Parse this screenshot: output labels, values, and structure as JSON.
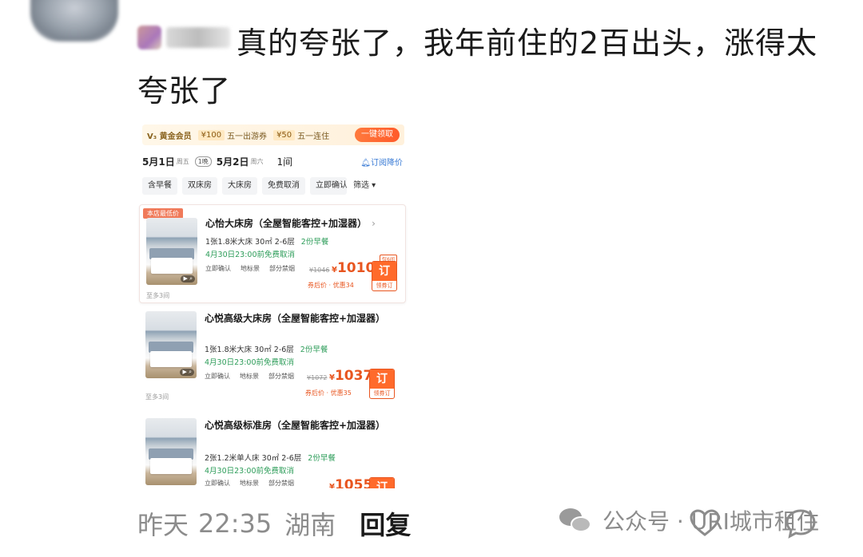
{
  "comment": {
    "text": "真的夸张了，我年前住的2百出头，涨得太夸张了"
  },
  "screenshot": {
    "member_bar": {
      "vip_label": "V₃ 黄金会员",
      "coupons": [
        {
          "amount": "¥100",
          "desc": "五一出游券"
        },
        {
          "amount": "¥50",
          "desc": "五一连住"
        }
      ],
      "claim_label": "一键领取"
    },
    "dates": {
      "checkin": "5月1日",
      "checkin_weekday": "周五",
      "nights": "1晚",
      "checkout": "5月2日",
      "checkout_weekday": "周六",
      "rooms": "1间",
      "subscribe": "订阅降价"
    },
    "filters": [
      "含早餐",
      "双床房",
      "大床房",
      "免费取消",
      "立即确认"
    ],
    "filter_button": "筛选 ▾",
    "lowest_tag": "本店最低价",
    "rooms": [
      {
        "title": "心怡大床房（全屋智能客控+加湿器）",
        "spec": "1张1.8米大床  30㎡  2-6层",
        "breakfast": "2份早餐",
        "cancel": "4月30日23:00前免费取消",
        "tags": [
          "立即确认",
          "地标景",
          "部分禁烟"
        ],
        "old_price": "¥1046",
        "price": "1010",
        "coupon": "券后价 · 优惠34",
        "remain": "仅6间",
        "order": "订",
        "order_sub": "领券订",
        "more": "至多3间"
      },
      {
        "title": "心悦高级大床房（全屋智能客控+加湿器）",
        "spec": "1张1.8米大床  30㎡  2-6层",
        "breakfast": "2份早餐",
        "cancel": "4月30日23:00前免费取消",
        "tags": [
          "立即确认",
          "地标景",
          "部分禁烟"
        ],
        "old_price": "¥1072",
        "price": "1037",
        "coupon": "券后价 · 优惠35",
        "order": "订",
        "order_sub": "领券订",
        "more": "至多3间"
      },
      {
        "title": "心悦高级标准房（全屋智能客控+加湿器）",
        "spec": "2张1.2米单人床  30㎡  2-6层",
        "breakfast": "2份早餐",
        "cancel": "4月30日23:00前免费取消",
        "tags": [
          "立即确认",
          "地标景",
          "部分禁烟"
        ],
        "price": "1055",
        "order": "订"
      }
    ]
  },
  "footer": {
    "date": "昨天",
    "time": "22:35",
    "location": "湖南",
    "reply": "回复"
  },
  "watermark": {
    "text": "公众号 · URI城市租住"
  },
  "icons": {
    "wechat": "wechat-icon",
    "heart": "heart-icon",
    "comment": "comment-icon"
  }
}
